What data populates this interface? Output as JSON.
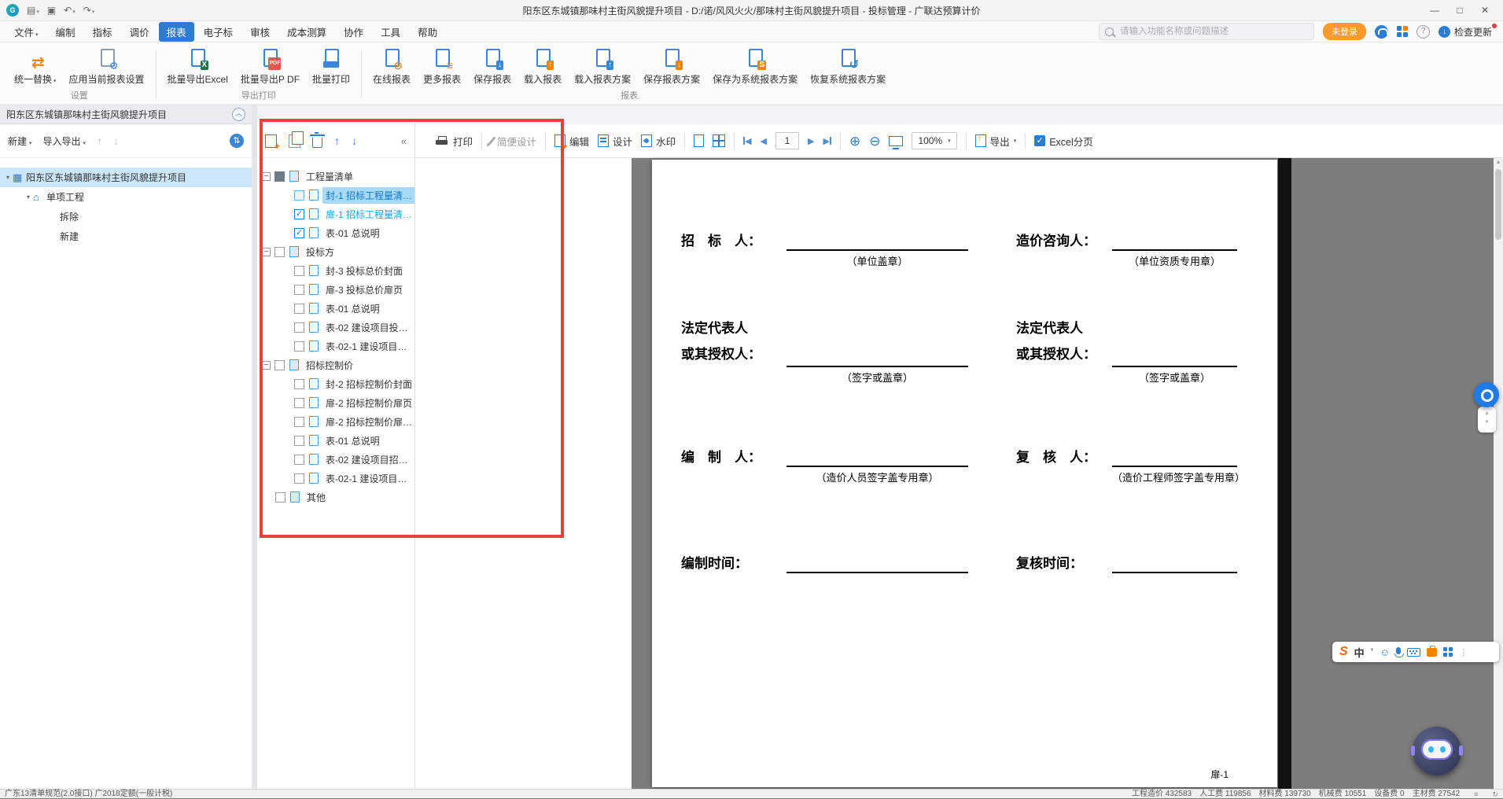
{
  "titlebar": {
    "title": "阳东区东城镇那味村主街风貌提升项目 - D:/诺/风风火火/那味村主街风貌提升项目 - 投标管理 - 广联达预算计价"
  },
  "menubar": {
    "items": [
      {
        "label": "文件",
        "caret": true
      },
      {
        "label": "编制"
      },
      {
        "label": "指标"
      },
      {
        "label": "调价"
      },
      {
        "label": "报表",
        "active": true
      },
      {
        "label": "电子标"
      },
      {
        "label": "审核"
      },
      {
        "label": "成本测算"
      },
      {
        "label": "协作"
      },
      {
        "label": "工具"
      },
      {
        "label": "帮助"
      }
    ],
    "search_placeholder": "请输入功能名称或问题描述",
    "login": "未登录",
    "check_update": "检查更新"
  },
  "ribbon": {
    "groups": [
      {
        "label": "设置",
        "buttons": [
          {
            "label": "统一替换",
            "icon": "unify-replace-icon",
            "caret": true
          },
          {
            "label": "应用当前报表设置",
            "icon": "apply-report-settings-icon"
          }
        ]
      },
      {
        "label": "导出打印",
        "buttons": [
          {
            "label": "批量导出Excel",
            "icon": "batch-export-excel-icon"
          },
          {
            "label": "批量导出P DF",
            "icon": "batch-export-pdf-icon"
          },
          {
            "label": "批量打印",
            "icon": "batch-print-icon"
          }
        ]
      },
      {
        "label": "报表",
        "buttons": [
          {
            "label": "在线报表",
            "icon": "online-report-icon"
          },
          {
            "label": "更多报表",
            "icon": "more-report-icon"
          },
          {
            "label": "保存报表",
            "icon": "save-report-icon"
          },
          {
            "label": "载入报表",
            "icon": "load-report-icon"
          },
          {
            "label": "载入报表方案",
            "icon": "load-report-plan-icon"
          },
          {
            "label": "保存报表方案",
            "icon": "save-report-plan-icon"
          },
          {
            "label": "保存为系统报表方案",
            "icon": "save-system-plan-icon"
          },
          {
            "label": "恢复系统报表方案",
            "icon": "restore-system-plan-icon"
          }
        ]
      }
    ]
  },
  "project_panel": {
    "header": "阳东区东城镇那味村主街风貌提升项目",
    "toolbar": {
      "new": "新建",
      "import_export": "导入导出"
    },
    "tree": [
      {
        "label": "阳东区东城镇那味村主街风貌提升项目",
        "level": 0,
        "icon": "project-icon",
        "selected": true,
        "caret": true
      },
      {
        "label": "单项工程",
        "level": 1,
        "icon": "house-icon",
        "caret": true
      },
      {
        "label": "拆除",
        "level": 2
      },
      {
        "label": "新建",
        "level": 2
      }
    ]
  },
  "report_panel": {
    "tree": [
      {
        "label": "工程量清单",
        "group": true,
        "expander": "minus",
        "check": "filled"
      },
      {
        "label": "封-1 招标工程量清…",
        "check": "none-sel",
        "selected": true
      },
      {
        "label": "扉-1 招标工程量清…",
        "check": "checked",
        "accent": true
      },
      {
        "label": "表-01 总说明",
        "check": "checked"
      },
      {
        "label": "投标方",
        "group": true,
        "expander": "minus",
        "check": "unchecked"
      },
      {
        "label": "封-3 投标总价封面",
        "check": "unchecked"
      },
      {
        "label": "扉-3 投标总价扉页",
        "check": "unchecked"
      },
      {
        "label": "表-01 总说明",
        "check": "unchecked"
      },
      {
        "label": "表-02 建设项目投…",
        "check": "unchecked"
      },
      {
        "label": "表-02-1 建设项目…",
        "check": "unchecked"
      },
      {
        "label": "招标控制价",
        "group": true,
        "expander": "minus",
        "check": "unchecked"
      },
      {
        "label": "封-2 招标控制价封面",
        "check": "unchecked"
      },
      {
        "label": "扉-2 招标控制价扉页",
        "check": "unchecked"
      },
      {
        "label": "扉-2 招标控制价扉…",
        "check": "unchecked"
      },
      {
        "label": "表-01 总说明",
        "check": "unchecked"
      },
      {
        "label": "表-02 建设项目招…",
        "check": "unchecked"
      },
      {
        "label": "表-02-1 建设项目…",
        "check": "unchecked"
      },
      {
        "label": "其他",
        "group": true,
        "check": "unchecked"
      }
    ]
  },
  "preview_toolbar": {
    "print": "打印",
    "simple_design": "简便设计",
    "edit": "编辑",
    "design": "设计",
    "watermark": "水印",
    "page_value": "1",
    "zoom_value": "100%",
    "export": "导出",
    "excel_paging": "Excel分页",
    "check_glyph": "✓"
  },
  "document": {
    "rows": [
      {
        "l1": "招　标　人：",
        "lnote": "（单位盖章）",
        "r1": "造价咨询人：",
        "rnote": "（单位资质专用章）"
      },
      {
        "l1": "法定代表人",
        "l2": "或其授权人：",
        "lnote": "（签字或盖章）",
        "r1": "法定代表人",
        "r2": "或其授权人：",
        "rnote": "（签字或盖章）"
      },
      {
        "l1": "编　制　人：",
        "lnote": "（造价人员签字盖专用章）",
        "r1": "复　核　人：",
        "rnote": "（造价工程师签字盖专用章）"
      },
      {
        "l1": "编制时间：",
        "r1": "复核时间："
      }
    ],
    "page_label": "扉-1"
  },
  "statusbar": {
    "left": "广东13清单规范(2.0接口) 广2018定额(一般计税)",
    "right": "工程造价 432583　人工费 119856　材料费 139730　机械费 10551　设备费 0　主材费 27542"
  }
}
